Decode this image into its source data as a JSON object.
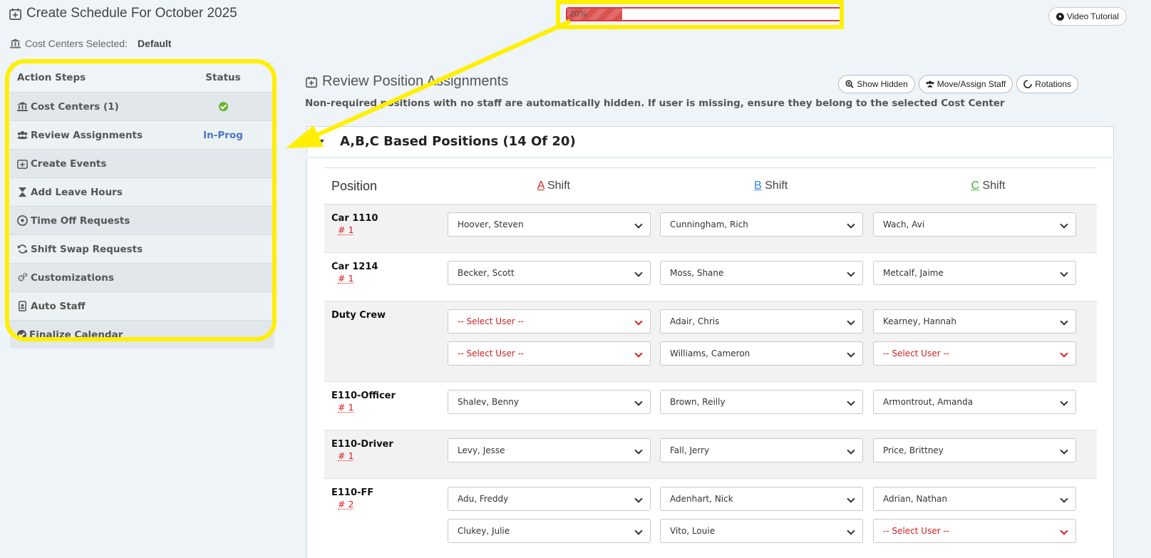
{
  "header": {
    "title": "Create Schedule For October 2025",
    "progress_text": "20%",
    "progress_value": 0.2,
    "video_tutorial": "Video Tutorial",
    "cost_centers_label": "Cost Centers Selected:",
    "cost_centers_value": "Default"
  },
  "sidebar": {
    "head_steps": "Action Steps",
    "head_status": "Status",
    "items": [
      {
        "label": "Cost Centers (1)",
        "status": ""
      },
      {
        "label": "Review Assignments",
        "status": "In-Prog"
      },
      {
        "label": "Create Events",
        "status": ""
      },
      {
        "label": "Add Leave Hours",
        "status": ""
      },
      {
        "label": "Time Off Requests",
        "status": ""
      },
      {
        "label": "Shift Swap Requests",
        "status": ""
      },
      {
        "label": "Customizations",
        "status": ""
      },
      {
        "label": "Auto Staff",
        "status": ""
      },
      {
        "label": "Finalize Calendar",
        "status": ""
      }
    ]
  },
  "main": {
    "title": "Review Position Assignments",
    "show_hidden": "Show Hidden",
    "move_assign": "Move/Assign Staff",
    "rotations": "Rotations",
    "notice": "Non-required positions with no staff are automatically hidden. If user is missing, ensure they belong to the selected Cost Center",
    "group_title": "A,B,C Based Positions (14 Of 20)",
    "col_position": "Position",
    "shift_a_letter": "A",
    "shift_b_letter": "B",
    "shift_c_letter": "C",
    "shift_word": "Shift",
    "rows": [
      {
        "position": "Car 1110",
        "num": "# 1",
        "a": [
          "Hoover, Steven"
        ],
        "b": [
          "Cunningham, Rich"
        ],
        "c": [
          "Wach, Avi"
        ]
      },
      {
        "position": "Car 1214",
        "num": "# 1",
        "a": [
          "Becker, Scott"
        ],
        "b": [
          "Moss, Shane"
        ],
        "c": [
          "Metcalf, Jaime"
        ]
      },
      {
        "position": "Duty Crew",
        "num": "",
        "a": [
          "-- Select User --",
          "-- Select User --"
        ],
        "b": [
          "Adair, Chris",
          "Williams, Cameron"
        ],
        "c": [
          "Kearney, Hannah",
          "-- Select User --"
        ]
      },
      {
        "position": "E110-Officer",
        "num": "# 1",
        "a": [
          "Shalev, Benny"
        ],
        "b": [
          "Brown, Reilly"
        ],
        "c": [
          "Armontrout, Amanda"
        ]
      },
      {
        "position": "E110-Driver",
        "num": "# 1",
        "a": [
          "Levy, Jesse"
        ],
        "b": [
          "Fall, Jerry"
        ],
        "c": [
          "Price, Brittney"
        ]
      },
      {
        "position": "E110-FF",
        "num": "# 2",
        "a": [
          "Adu, Freddy",
          "Clukey, Julie"
        ],
        "b": [
          "Adenhart, Nick",
          "Vito, Louie"
        ],
        "c": [
          "Adrian, Nathan",
          "-- Select User --"
        ]
      }
    ]
  }
}
